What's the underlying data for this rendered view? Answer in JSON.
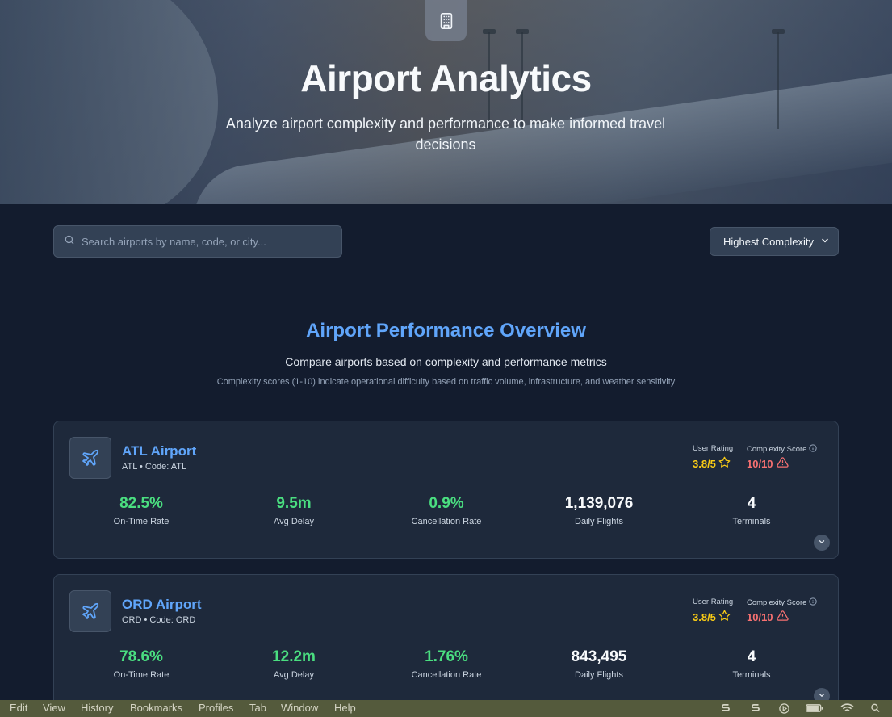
{
  "hero": {
    "title": "Airport Analytics",
    "subtitle": "Analyze airport complexity and performance to make informed travel decisions",
    "icon": "building-icon"
  },
  "search": {
    "placeholder": "Search airports by name, code, or city...",
    "value": ""
  },
  "sort": {
    "selected": "Highest Complexity"
  },
  "section": {
    "title": "Airport Performance Overview",
    "subtitle": "Compare airports based on complexity and performance metrics",
    "note": "Complexity scores (1-10) indicate operational difficulty based on traffic volume, infrastructure, and weather sensitivity"
  },
  "labels": {
    "user_rating": "User Rating",
    "complexity_score": "Complexity Score",
    "on_time": "On-Time Rate",
    "avg_delay": "Avg Delay",
    "cancellation": "Cancellation Rate",
    "daily_flights": "Daily Flights",
    "terminals": "Terminals"
  },
  "airports": [
    {
      "name": "ATL Airport",
      "code_line": "ATL • Code: ATL",
      "rating": "3.8/5",
      "complexity": "10/10",
      "on_time": "82.5%",
      "avg_delay": "9.5m",
      "cancellation": "0.9%",
      "daily_flights": "1,139,076",
      "terminals": "4"
    },
    {
      "name": "ORD Airport",
      "code_line": "ORD • Code: ORD",
      "rating": "3.8/5",
      "complexity": "10/10",
      "on_time": "78.6%",
      "avg_delay": "12.2m",
      "cancellation": "1.76%",
      "daily_flights": "843,495",
      "terminals": "4"
    }
  ],
  "menubar": {
    "items": [
      "Edit",
      "View",
      "History",
      "Bookmarks",
      "Profiles",
      "Tab",
      "Window",
      "Help"
    ]
  },
  "colors": {
    "accent": "#60a5fa",
    "success": "#4ade80",
    "rating": "#facc15",
    "danger": "#f87171",
    "background": "#131c2e",
    "card": "#1e293b"
  }
}
